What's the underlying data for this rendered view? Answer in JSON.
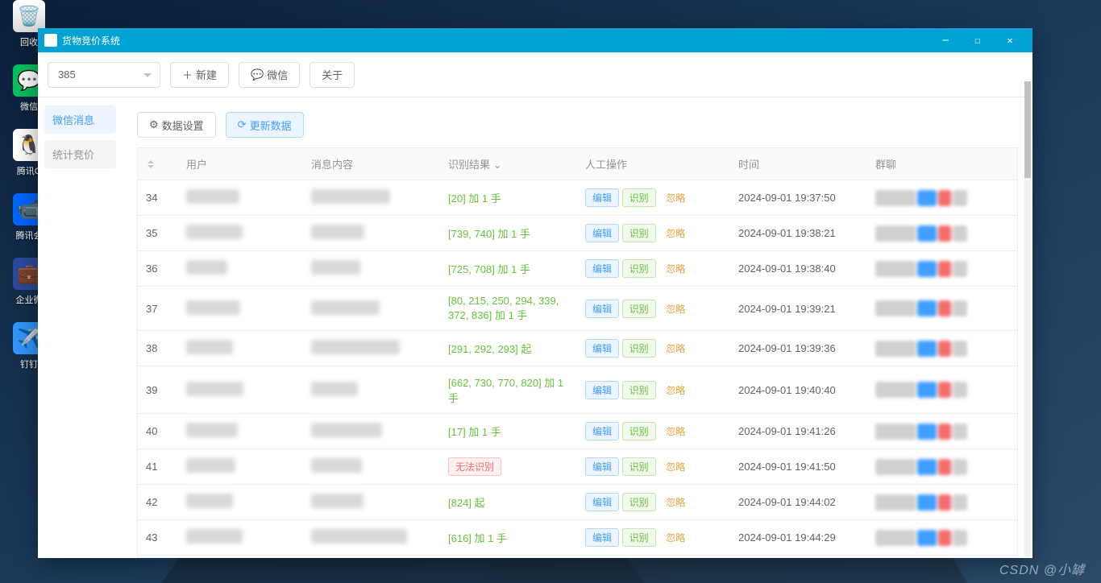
{
  "desktop": {
    "recycle_bin": "回收",
    "wechat": "微信",
    "qq": "腾讯Q",
    "meeting": "腾讯会",
    "ewechat": "企业微",
    "dingtalk": "钉钉"
  },
  "window": {
    "title": "货物竞价系统"
  },
  "toolbar": {
    "select_value": "385",
    "new_btn": "新建",
    "wechat_btn": "微信",
    "about_btn": "关于"
  },
  "sidebar": {
    "tabs": [
      "微信消息",
      "统计竞价"
    ]
  },
  "content": {
    "data_settings": "数据设置",
    "refresh_data": "更新数据"
  },
  "table": {
    "headers": {
      "idx": "",
      "user": "用户",
      "content": "消息内容",
      "result": "识别结果",
      "actions": "人工操作",
      "time": "时间",
      "group": "群聊"
    },
    "action_labels": {
      "edit": "编辑",
      "recognize": "识别",
      "ignore": "忽略"
    },
    "rows": [
      {
        "idx": "34",
        "result": "[20] 加 1 手",
        "result_type": "green",
        "time": "2024-09-01 19:37:50"
      },
      {
        "idx": "35",
        "result": "[739, 740] 加 1 手",
        "result_type": "green",
        "time": "2024-09-01 19:38:21"
      },
      {
        "idx": "36",
        "result": "[725, 708] 加 1 手",
        "result_type": "green",
        "time": "2024-09-01 19:38:40"
      },
      {
        "idx": "37",
        "result": "[80, 215, 250, 294, 339, 372, 836] 加 1 手",
        "result_type": "green",
        "time": "2024-09-01 19:39:21"
      },
      {
        "idx": "38",
        "result": "[291, 292, 293] 起",
        "result_type": "green",
        "time": "2024-09-01 19:39:36"
      },
      {
        "idx": "39",
        "result": "[662, 730, 770, 820] 加 1 手",
        "result_type": "green",
        "time": "2024-09-01 19:40:40"
      },
      {
        "idx": "40",
        "result": "[17] 加 1 手",
        "result_type": "green",
        "time": "2024-09-01 19:41:26"
      },
      {
        "idx": "41",
        "result": "无法识别",
        "result_type": "red-tag",
        "time": "2024-09-01 19:41:50"
      },
      {
        "idx": "42",
        "result": "[824] 起",
        "result_type": "green",
        "time": "2024-09-01 19:44:02"
      },
      {
        "idx": "43",
        "result": "[616] 加 1 手",
        "result_type": "green",
        "time": "2024-09-01 19:44:29"
      }
    ]
  },
  "watermark": "CSDN @小罅"
}
